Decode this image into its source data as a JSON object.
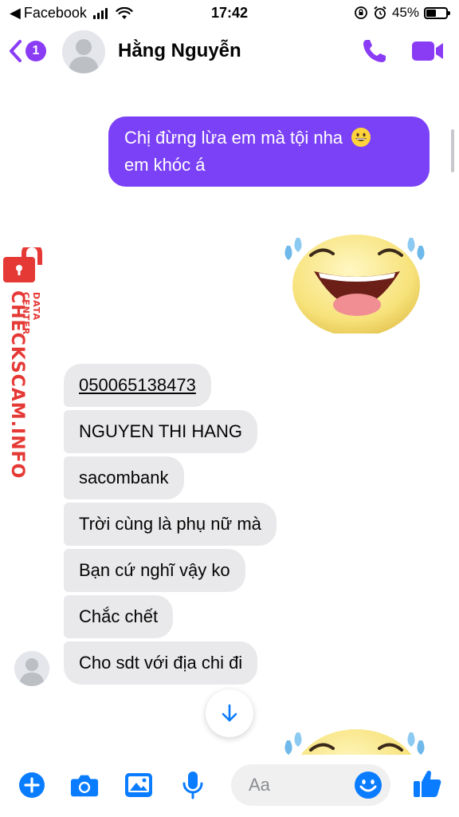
{
  "status_bar": {
    "back_app": "Facebook",
    "time": "17:42",
    "battery": "45%"
  },
  "header": {
    "unread_count": "1",
    "contact_name": "Hằng Nguyễn",
    "accent_color": "#8a3cf5"
  },
  "conversation": {
    "outgoing": {
      "line1": "Chị đừng lừa em mà tội nha",
      "line2": "em khóc á",
      "bubble_color": "#7b41f6"
    },
    "incoming": [
      {
        "text": "050065138473"
      },
      {
        "text": "NGUYEN THI HANG"
      },
      {
        "text": "sacombank"
      },
      {
        "text": "Trời cùng là phụ nữ mà"
      },
      {
        "text": "Bạn cứ nghĩ vậy ko"
      },
      {
        "text": "Chắc chết"
      },
      {
        "text": "Cho sdt với địa chi đi"
      }
    ]
  },
  "watermark": {
    "main": "CHECKSCAM.INFO",
    "sub": "DATA CENTER",
    "color": "#e53935"
  },
  "composer": {
    "placeholder": "Aa"
  },
  "icons": {
    "back": "chevron-left-icon",
    "call": "phone-icon",
    "video": "video-camera-icon",
    "add": "plus-circle-icon",
    "camera": "camera-icon",
    "gallery": "image-icon",
    "mic": "microphone-icon",
    "emoji": "smiley-icon",
    "like": "thumbs-up-icon",
    "jump": "arrow-down-icon"
  }
}
